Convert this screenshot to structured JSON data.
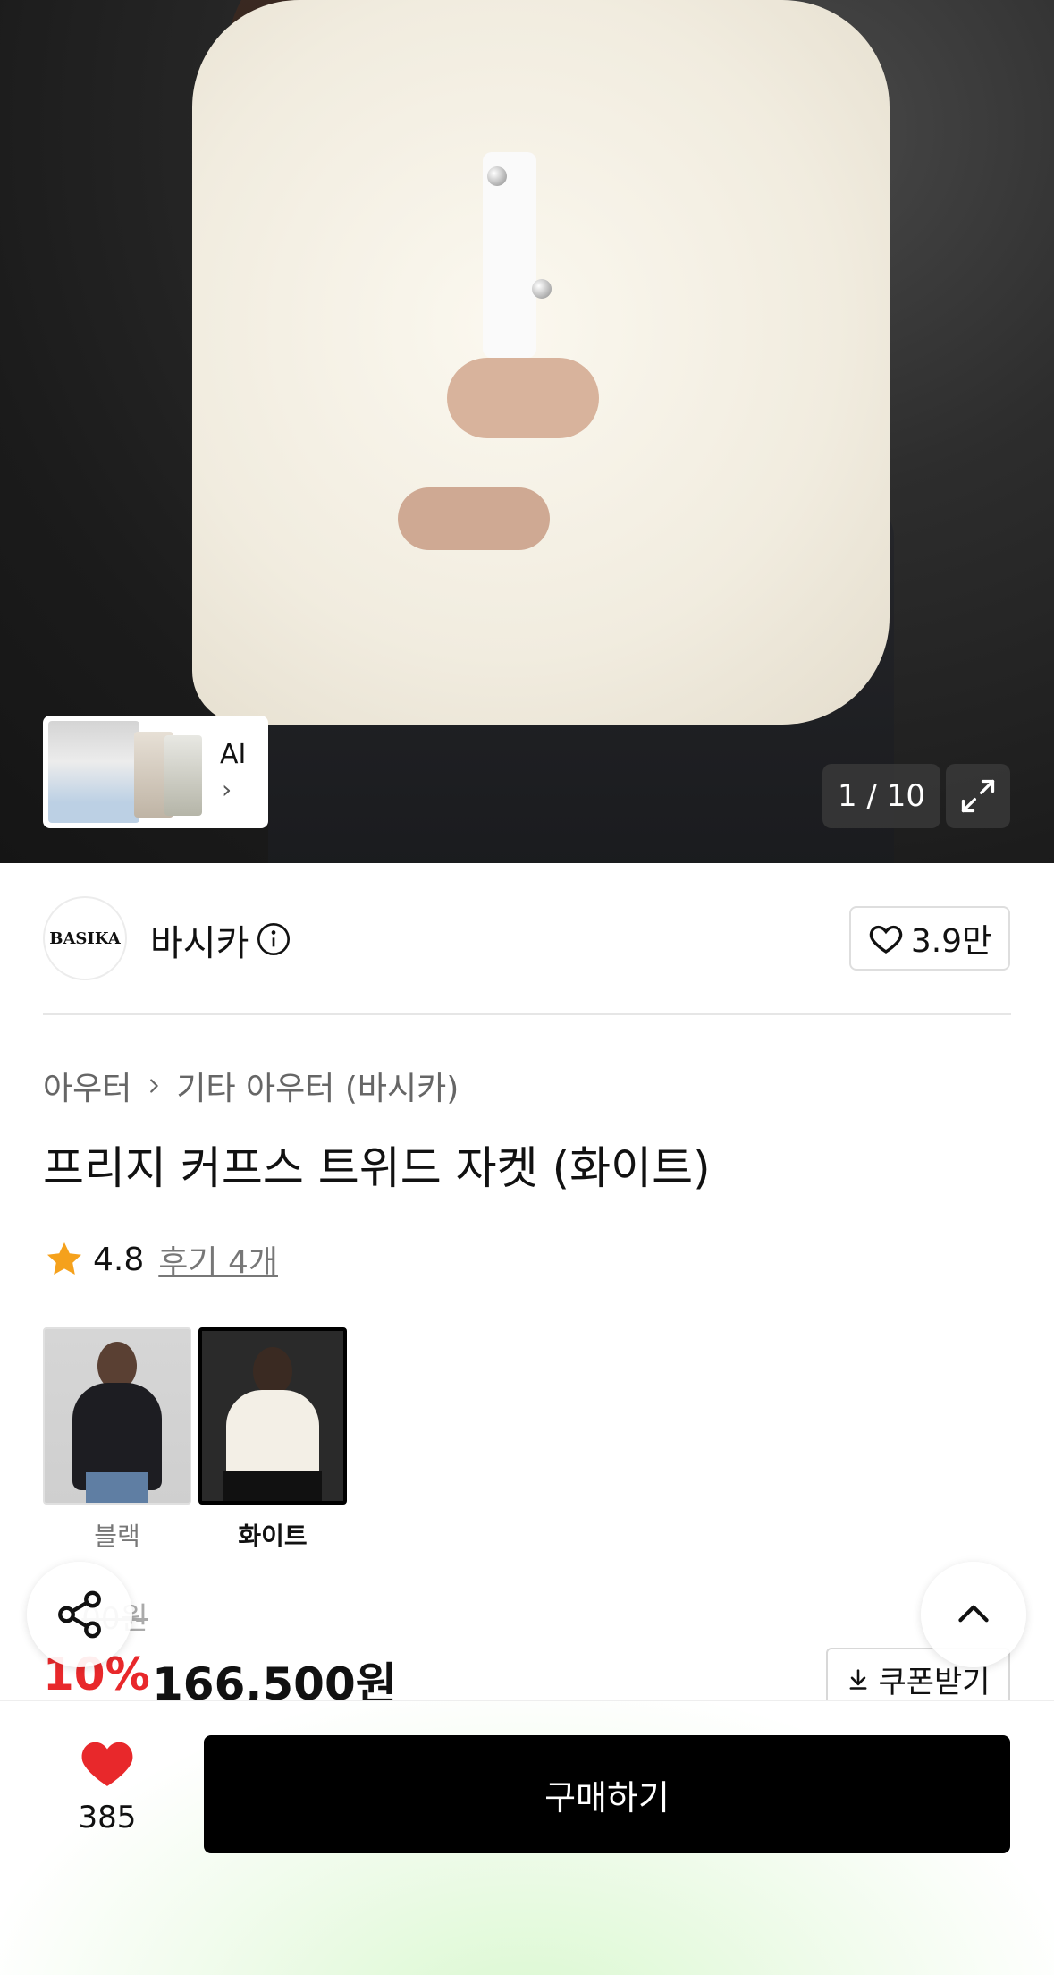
{
  "gallery": {
    "counter": "1 / 10",
    "ai_label": "AI"
  },
  "brand": {
    "logo_text": "BASIKA",
    "name": "바시카",
    "like_count": "3.9만"
  },
  "breadcrumb": {
    "category": "아우터",
    "subcategory": "기타 아우터 (바시카)"
  },
  "product": {
    "title": "프리지 커프스 트위드 자켓 (화이트)",
    "rating": "4.8",
    "review_text": "후기 4개"
  },
  "options": [
    {
      "label": "블랙",
      "selected": false
    },
    {
      "label": "화이트",
      "selected": true
    }
  ],
  "price": {
    "original_fragment": "00원",
    "discount": "10%",
    "final": "166,500원",
    "coupon_label": "쿠폰받기"
  },
  "bottom_bar": {
    "wish_count": "385",
    "buy_label": "구매하기"
  },
  "colors": {
    "accent_red": "#e8282b",
    "buy_button": "#000000",
    "heart": "#e8282b",
    "rating_star": "#f5a11c"
  }
}
